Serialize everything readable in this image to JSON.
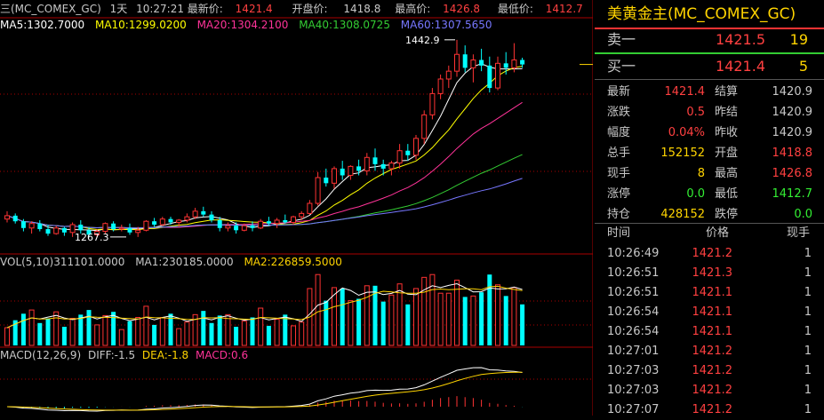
{
  "header": {
    "prefix": "三(MC_COMEX_GC)",
    "period": "1天",
    "time": "10:27:21",
    "latest_label": "最新价:",
    "latest": "1421.4",
    "open_label": "开盘价:",
    "open": "1418.8",
    "high_label": "最高价:",
    "high": "1426.8",
    "low_label": "最低价:",
    "low": "1412.7"
  },
  "ma": {
    "ma5": "MA5:1302.7000",
    "ma10": "MA10:1299.0200",
    "ma20": "MA20:1304.2100",
    "ma40": "MA40:1308.0725",
    "ma60": "MA60:1307.5650"
  },
  "annotations": {
    "peak": "1442.9",
    "trough": "1267.3"
  },
  "vol": {
    "main": "VOL(5,10)311101.0000",
    "ma1": "MA1:230185.0000",
    "ma2": "MA2:226859.5000"
  },
  "macd": {
    "params": "MACD(12,26,9)",
    "diff": "DIFF:-1.5",
    "dea": "DEA:-1.8",
    "macd": "MACD:0.6"
  },
  "colors": {
    "up": "#ff3333",
    "down": "#00ffff",
    "yellow": "#ffd400",
    "ma5": "#ffffff",
    "ma10": "#ffff00",
    "ma20": "#ff3399",
    "ma40": "#33cc33",
    "ma60": "#7777ff"
  },
  "quote": {
    "title": "美黄金主(MC_COMEX_GC)",
    "sell_label": "卖一",
    "sell_price": "1421.5",
    "sell_vol": "19",
    "buy_label": "买一",
    "buy_price": "1421.4",
    "buy_vol": "5"
  },
  "stats": [
    {
      "l1": "最新",
      "v1": "1421.4",
      "l2": "结算",
      "v2": "1420.9"
    },
    {
      "l1": "涨跌",
      "v1": "0.5",
      "l2": "昨结",
      "v2": "1420.9"
    },
    {
      "l1": "幅度",
      "v1": "0.04%",
      "l2": "昨收",
      "v2": "1420.9"
    },
    {
      "l1": "总手",
      "v1": "152152",
      "l2": "开盘",
      "v2": "1418.8"
    },
    {
      "l1": "现手",
      "v1": "8",
      "l2": "最高",
      "v2": "1426.8"
    },
    {
      "l1": "涨停",
      "v1": "0.0",
      "l2": "最低",
      "v2": "1412.7"
    },
    {
      "l1": "持仓",
      "v1": "428152",
      "l2": "跌停",
      "v2": "0.0"
    }
  ],
  "ticks_header": {
    "time": "时间",
    "price": "价格",
    "volume": "现手"
  },
  "ticks": [
    {
      "time": "10:26:49",
      "price": "1421.2",
      "volume": "1"
    },
    {
      "time": "10:26:51",
      "price": "1421.3",
      "volume": "1"
    },
    {
      "time": "10:26:51",
      "price": "1421.1",
      "volume": "1"
    },
    {
      "time": "10:26:54",
      "price": "1421.1",
      "volume": "1"
    },
    {
      "time": "10:26:54",
      "price": "1421.1",
      "volume": "1"
    },
    {
      "time": "10:27:01",
      "price": "1421.2",
      "volume": "1"
    },
    {
      "time": "10:27:03",
      "price": "1421.2",
      "volume": "1"
    },
    {
      "time": "10:27:03",
      "price": "1421.2",
      "volume": "1"
    },
    {
      "time": "10:27:07",
      "price": "1421.2",
      "volume": "1"
    }
  ],
  "chart_data": {
    "type": "candlestick",
    "ylim": [
      1255,
      1450
    ],
    "annotations": [
      "1442.9",
      "1267.3"
    ],
    "candles": [
      [
        1283,
        1290,
        1280,
        1286
      ],
      [
        1286,
        1288,
        1279,
        1281
      ],
      [
        1281,
        1283,
        1272,
        1275
      ],
      [
        1275,
        1281,
        1270,
        1279
      ],
      [
        1279,
        1282,
        1272,
        1274
      ],
      [
        1274,
        1278,
        1268,
        1270
      ],
      [
        1270,
        1277,
        1269,
        1275
      ],
      [
        1275,
        1276,
        1268,
        1271
      ],
      [
        1271,
        1280,
        1267,
        1278
      ],
      [
        1278,
        1282,
        1270,
        1273
      ],
      [
        1273,
        1276,
        1267,
        1269
      ],
      [
        1269,
        1274,
        1267,
        1272
      ],
      [
        1272,
        1280,
        1270,
        1279
      ],
      [
        1279,
        1281,
        1272,
        1274
      ],
      [
        1274,
        1278,
        1272,
        1275
      ],
      [
        1275,
        1279,
        1269,
        1271
      ],
      [
        1271,
        1276,
        1267,
        1273
      ],
      [
        1273,
        1282,
        1272,
        1281
      ],
      [
        1281,
        1284,
        1276,
        1278
      ],
      [
        1278,
        1285,
        1277,
        1283
      ],
      [
        1283,
        1285,
        1278,
        1280
      ],
      [
        1280,
        1283,
        1276,
        1282
      ],
      [
        1282,
        1288,
        1280,
        1285
      ],
      [
        1285,
        1293,
        1283,
        1290
      ],
      [
        1290,
        1294,
        1285,
        1287
      ],
      [
        1287,
        1290,
        1280,
        1282
      ],
      [
        1282,
        1285,
        1272,
        1275
      ],
      [
        1275,
        1280,
        1272,
        1277
      ],
      [
        1277,
        1280,
        1270,
        1273
      ],
      [
        1273,
        1279,
        1272,
        1277
      ],
      [
        1277,
        1281,
        1272,
        1275
      ],
      [
        1275,
        1283,
        1274,
        1281
      ],
      [
        1281,
        1285,
        1277,
        1279
      ],
      [
        1279,
        1284,
        1275,
        1282
      ],
      [
        1282,
        1287,
        1279,
        1280
      ],
      [
        1280,
        1286,
        1278,
        1285
      ],
      [
        1285,
        1290,
        1282,
        1288
      ],
      [
        1288,
        1300,
        1287,
        1297
      ],
      [
        1297,
        1325,
        1295,
        1320
      ],
      [
        1320,
        1328,
        1312,
        1315
      ],
      [
        1315,
        1330,
        1310,
        1328
      ],
      [
        1328,
        1335,
        1318,
        1322
      ],
      [
        1322,
        1331,
        1318,
        1330
      ],
      [
        1330,
        1336,
        1322,
        1326
      ],
      [
        1326,
        1342,
        1322,
        1338
      ],
      [
        1338,
        1346,
        1326,
        1332
      ],
      [
        1332,
        1336,
        1322,
        1328
      ],
      [
        1328,
        1335,
        1322,
        1333
      ],
      [
        1333,
        1350,
        1328,
        1344
      ],
      [
        1344,
        1350,
        1335,
        1340
      ],
      [
        1340,
        1358,
        1336,
        1355
      ],
      [
        1355,
        1380,
        1350,
        1376
      ],
      [
        1376,
        1400,
        1372,
        1395
      ],
      [
        1395,
        1412,
        1390,
        1408
      ],
      [
        1408,
        1420,
        1400,
        1415
      ],
      [
        1415,
        1443,
        1410,
        1430
      ],
      [
        1430,
        1438,
        1414,
        1418
      ],
      [
        1418,
        1430,
        1405,
        1425
      ],
      [
        1425,
        1435,
        1415,
        1420
      ],
      [
        1420,
        1428,
        1396,
        1400
      ],
      [
        1400,
        1428,
        1398,
        1422
      ],
      [
        1422,
        1432,
        1412,
        1418
      ],
      [
        1418,
        1440,
        1414,
        1425
      ],
      [
        1425,
        1427,
        1418,
        1421
      ]
    ],
    "volume_ylim": [
      0,
      400000
    ],
    "macd_ylim": [
      -20,
      40
    ]
  }
}
